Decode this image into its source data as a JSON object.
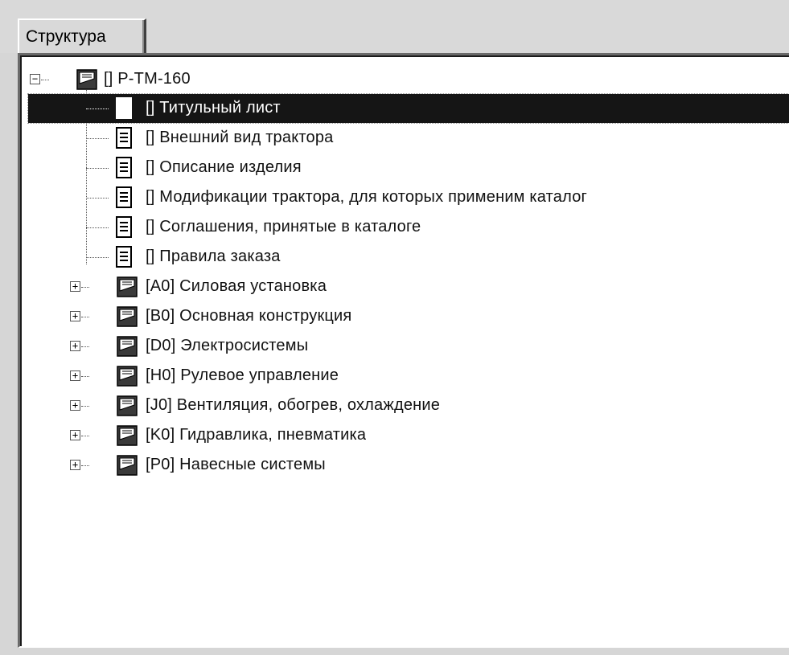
{
  "tabs": [
    {
      "label": "Структура",
      "active": true
    }
  ],
  "tree": {
    "root": {
      "label": "[] P-TM-160",
      "expanded": true,
      "icon": "folder-book-icon"
    },
    "children": [
      {
        "label": "[] Титульный лист",
        "icon": "document-icon",
        "selected": true
      },
      {
        "label": "[] Внешний вид трактора",
        "icon": "document-icon"
      },
      {
        "label": "[] Описание изделия",
        "icon": "document-icon"
      },
      {
        "label": "[] Модификации трактора, для которых применим каталог",
        "icon": "document-icon"
      },
      {
        "label": "[] Соглашения, принятые в каталоге",
        "icon": "document-icon"
      },
      {
        "label": "[] Правила заказа",
        "icon": "document-icon"
      },
      {
        "label": "[A0] Силовая установка",
        "icon": "folder-book-icon",
        "expanded": false
      },
      {
        "label": "[B0] Основная конструкция",
        "icon": "folder-book-icon",
        "expanded": false
      },
      {
        "label": "[D0] Электросистемы",
        "icon": "folder-book-icon",
        "expanded": false
      },
      {
        "label": "[H0] Рулевое управление",
        "icon": "folder-book-icon",
        "expanded": false
      },
      {
        "label": "[J0] Вентиляция, обогрев, охлаждение",
        "icon": "folder-book-icon",
        "expanded": false
      },
      {
        "label": "[K0] Гидравлика, пневматика",
        "icon": "folder-book-icon",
        "expanded": false
      },
      {
        "label": "[P0] Навесные системы",
        "icon": "folder-book-icon",
        "expanded": false
      }
    ]
  },
  "colors": {
    "selection": "#151515",
    "panel": "#d9d9d9",
    "tree_bg": "#ffffff"
  }
}
